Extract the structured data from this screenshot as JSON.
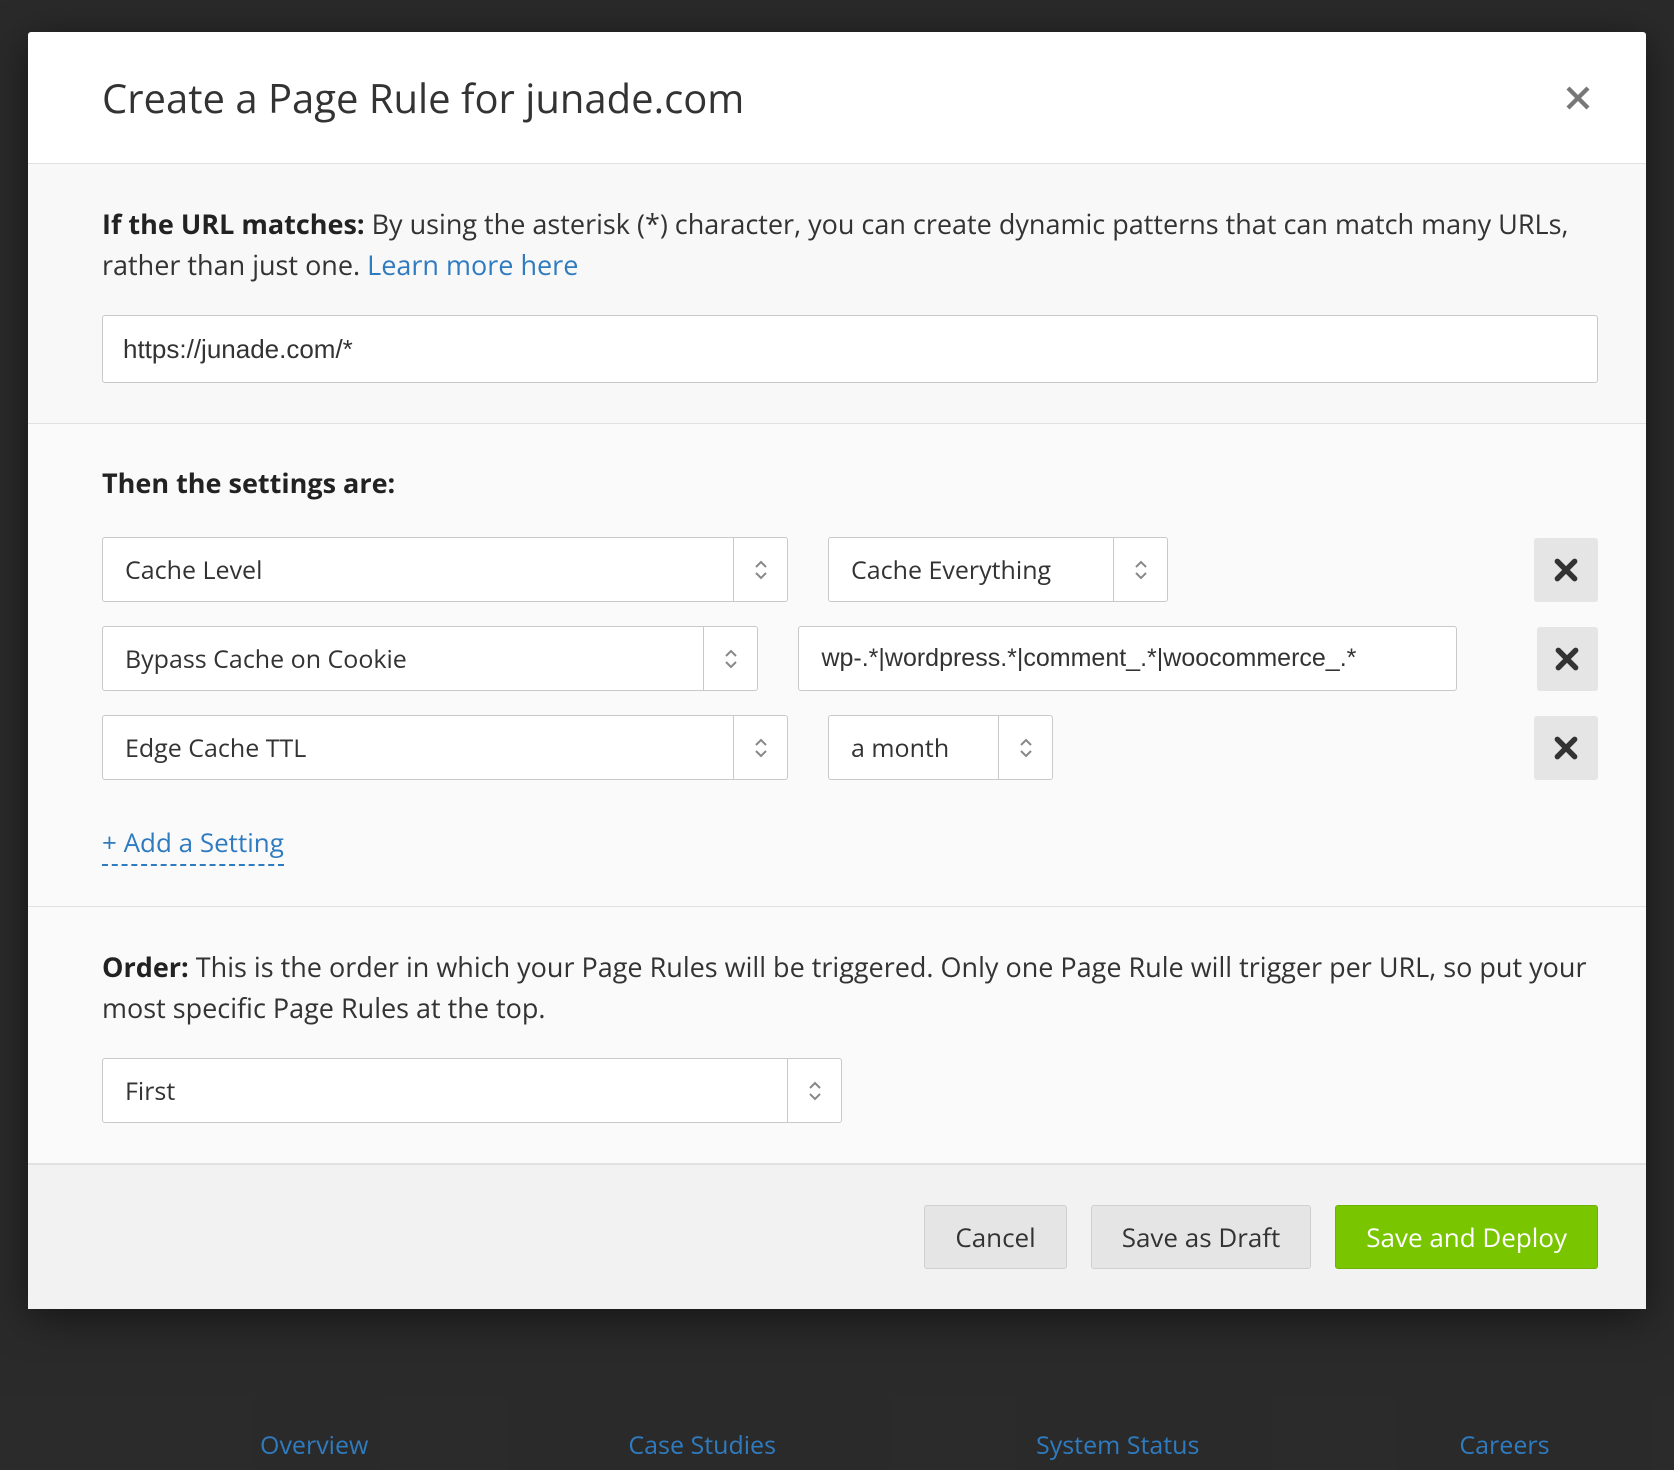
{
  "modal": {
    "title": "Create a Page Rule for junade.com",
    "url_section": {
      "label": "If the URL matches:",
      "description": "By using the asterisk (*) character, you can create dynamic patterns that can match many URLs, rather than just one.",
      "learn_more": "Learn more here",
      "url_value": "https://junade.com/*"
    },
    "settings_section": {
      "heading": "Then the settings are:",
      "rows": [
        {
          "setting": "Cache Level",
          "value_type": "select",
          "value": "Cache Everything"
        },
        {
          "setting": "Bypass Cache on Cookie",
          "value_type": "text",
          "value": "wp-.*|wordpress.*|comment_.*|woocommerce_.*"
        },
        {
          "setting": "Edge Cache TTL",
          "value_type": "select",
          "value": "a month"
        }
      ],
      "add_setting": "+ Add a Setting"
    },
    "order_section": {
      "label": "Order:",
      "description": "This is the order in which your Page Rules will be triggered. Only one Page Rule will trigger per URL, so put your most specific Page Rules at the top.",
      "value": "First"
    },
    "footer": {
      "cancel": "Cancel",
      "draft": "Save as Draft",
      "deploy": "Save and Deploy"
    }
  },
  "background_links": [
    "Overview",
    "Case Studies",
    "System Status",
    "Careers"
  ]
}
